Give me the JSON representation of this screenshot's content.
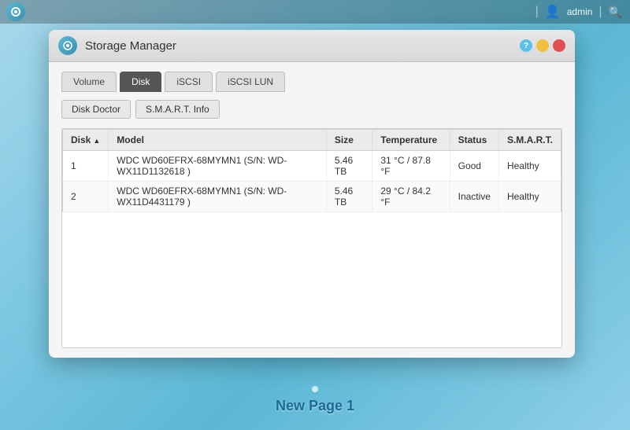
{
  "taskbar": {
    "user_icon": "👤",
    "username": "admin",
    "search_icon": "🔍",
    "divider": "|"
  },
  "page": {
    "label": "New Page 1"
  },
  "window": {
    "title": "Storage Manager",
    "controls": {
      "help_label": "?",
      "minimize_label": "",
      "close_label": ""
    },
    "tabs": [
      {
        "id": "volume",
        "label": "Volume",
        "active": false
      },
      {
        "id": "disk",
        "label": "Disk",
        "active": true
      },
      {
        "id": "iscsi",
        "label": "iSCSI",
        "active": false
      },
      {
        "id": "iscsi-lun",
        "label": "iSCSI LUN",
        "active": false
      }
    ],
    "action_buttons": [
      {
        "id": "disk-doctor",
        "label": "Disk Doctor"
      },
      {
        "id": "smart-info",
        "label": "S.M.A.R.T. Info"
      }
    ],
    "table": {
      "columns": [
        {
          "id": "disk",
          "label": "Disk",
          "sortable": true,
          "sort_indicator": "▲"
        },
        {
          "id": "model",
          "label": "Model",
          "sortable": false
        },
        {
          "id": "size",
          "label": "Size",
          "sortable": false
        },
        {
          "id": "temperature",
          "label": "Temperature",
          "sortable": false
        },
        {
          "id": "status",
          "label": "Status",
          "sortable": false
        },
        {
          "id": "smart",
          "label": "S.M.A.R.T.",
          "sortable": false
        }
      ],
      "rows": [
        {
          "disk": "1",
          "model": "WDC WD60EFRX-68MYMN1 (S/N: WD-WX11D1132618 )",
          "size": "5.46 TB",
          "temperature": "31 °C / 87.8 °F",
          "status": "Good",
          "smart": "Healthy"
        },
        {
          "disk": "2",
          "model": "WDC WD60EFRX-68MYMN1 (S/N: WD-WX11D4431179 )",
          "size": "5.46 TB",
          "temperature": "29 °C / 84.2 °F",
          "status": "Inactive",
          "smart": "Healthy"
        }
      ]
    }
  }
}
